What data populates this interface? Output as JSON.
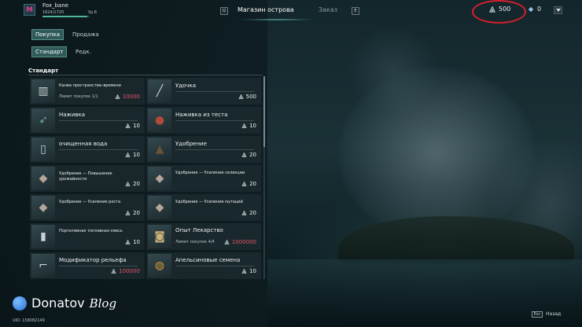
{
  "player": {
    "name": "Fox_bane",
    "xp": "1624/1720",
    "xp_fraction": 0.944,
    "level": "Ур.8",
    "logo_letter": "M"
  },
  "nav": {
    "prev_key": "Q",
    "tab_shop": "Магазин острова",
    "tab_order": "Заказ",
    "next_key": "E"
  },
  "currency": {
    "primary_value": "500",
    "secondary_value": "0",
    "primary_icon": "ark-token-icon",
    "secondary_icon": "crystal-icon",
    "highlight_color": "#d4212a"
  },
  "tabs": {
    "buy": "Покупка",
    "sell": "Продажа",
    "standard": "Стандарт",
    "rare": "Редк."
  },
  "section": {
    "title": "Стандарт"
  },
  "items": [
    {
      "name": "Канва пространства–времени",
      "limit": "Лимит покупок 1/1",
      "price": "10000",
      "price_red": true,
      "icon": "canvas-easel-icon"
    },
    {
      "name": "Удочка",
      "limit": "",
      "price": "500",
      "price_red": false,
      "icon": "fishing-rod-icon"
    },
    {
      "name": "Наживка",
      "limit": "",
      "price": "10",
      "price_red": false,
      "icon": "bait-fish-icon"
    },
    {
      "name": "Наживка из теста",
      "limit": "",
      "price": "10",
      "price_red": false,
      "icon": "dough-bait-icon"
    },
    {
      "name": "очищенная вода",
      "limit": "",
      "price": "10",
      "price_red": false,
      "icon": "water-tank-icon"
    },
    {
      "name": "Удобрение",
      "limit": "",
      "price": "20",
      "price_red": false,
      "icon": "fertilizer-pile-icon"
    },
    {
      "name": "Удобрение — Повышение урожайности",
      "limit": "",
      "price": "20",
      "price_red": false,
      "icon": "fertilizer-bag-icon"
    },
    {
      "name": "Удобрение — Усиление селекции",
      "limit": "",
      "price": "20",
      "price_red": false,
      "icon": "fertilizer-bag-icon"
    },
    {
      "name": "Удобрение — Усиление роста",
      "limit": "",
      "price": "20",
      "price_red": false,
      "icon": "fertilizer-bag-icon"
    },
    {
      "name": "Удобрение — Усиление мутаций",
      "limit": "",
      "price": "20",
      "price_red": false,
      "icon": "fertilizer-bag-icon"
    },
    {
      "name": "Портативная топливная смесь",
      "limit": "",
      "price": "10",
      "price_red": false,
      "icon": "fuel-canister-icon"
    },
    {
      "name": "Опыт Лекарство",
      "limit": "Лимит покупок 4/4",
      "price": "1000000",
      "price_red": true,
      "icon": "medicine-jar-icon"
    },
    {
      "name": "Модификатор рельефа",
      "limit": "",
      "price": "100000",
      "price_red": true,
      "icon": "terrain-tool-icon"
    },
    {
      "name": "Апельсиновые семена",
      "limit": "",
      "price": "10",
      "price_red": false,
      "icon": "seed-jar-icon"
    }
  ],
  "footer": {
    "uid": "UID:  158082149",
    "esc_key": "Esc",
    "back_label": "Назад"
  },
  "watermark": {
    "brand": "Donatov",
    "suffix": "Blog"
  }
}
